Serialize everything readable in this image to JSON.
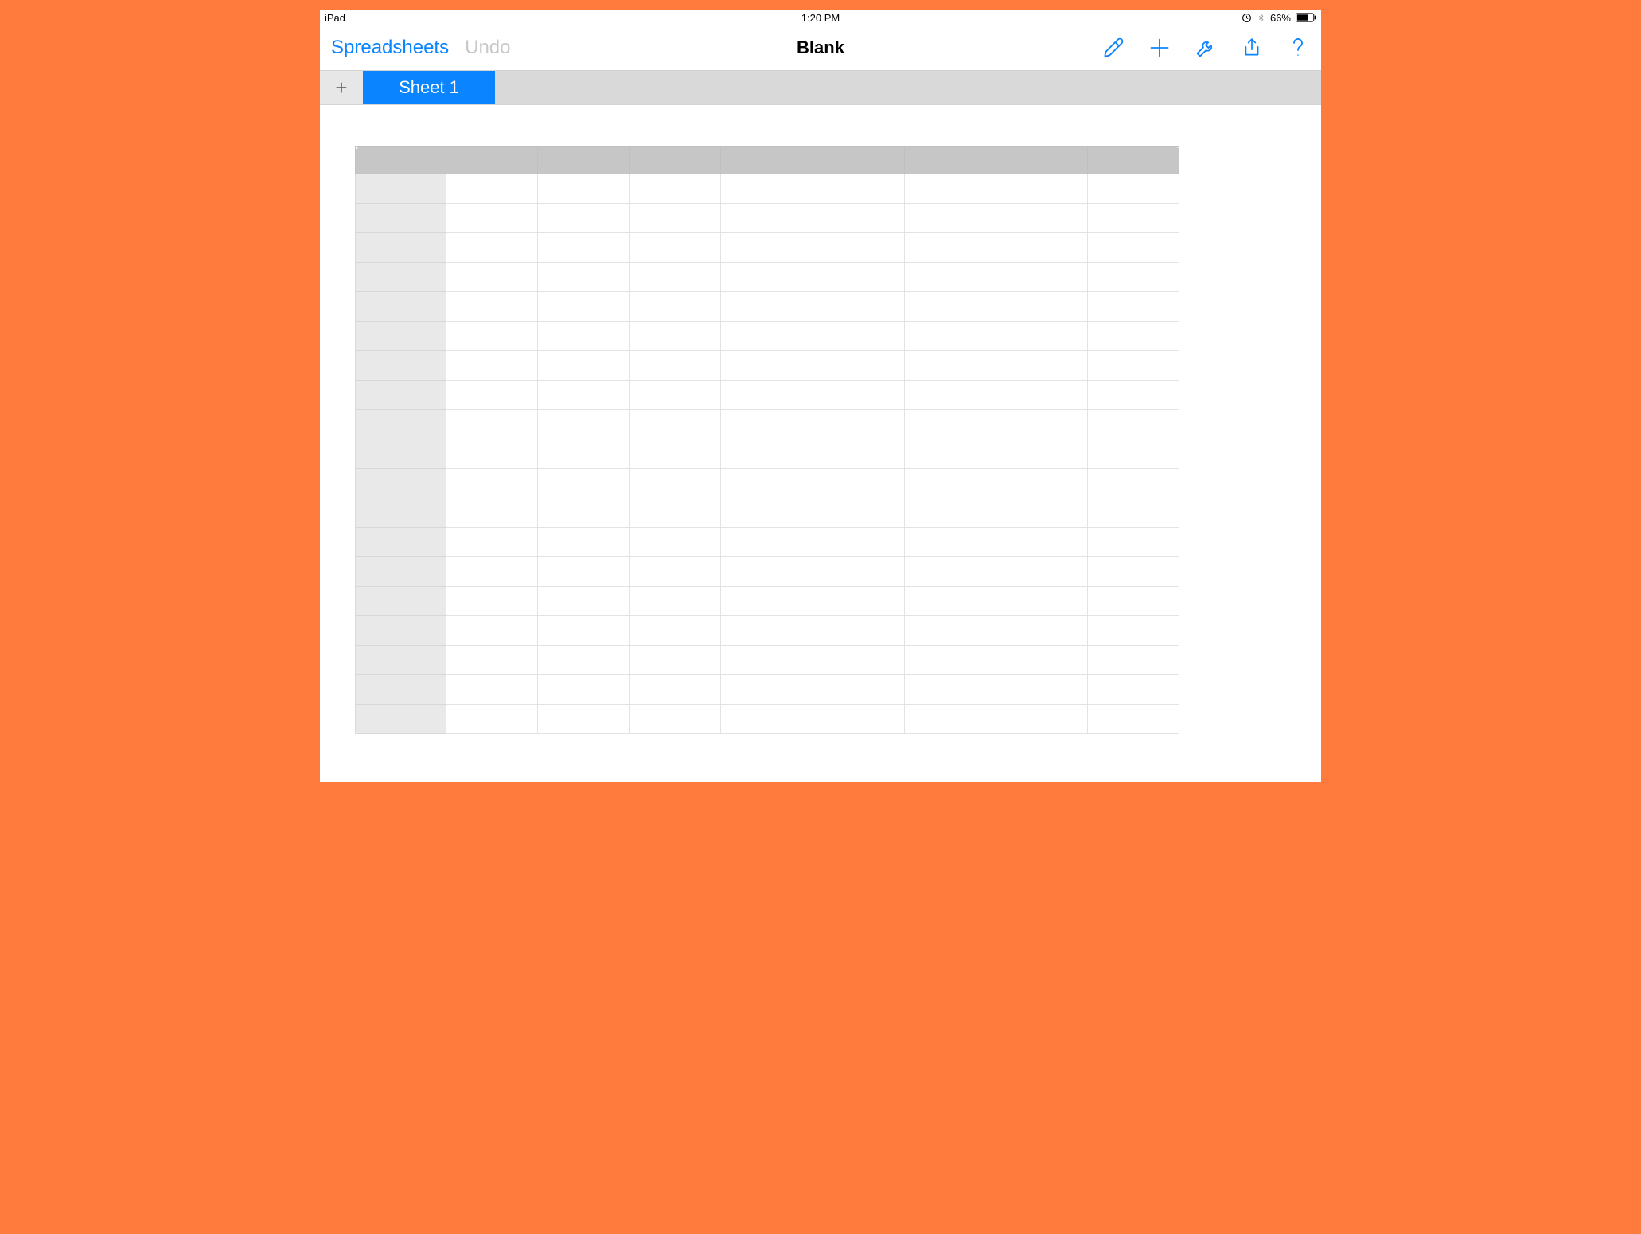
{
  "status_bar": {
    "device_label": "iPad",
    "time": "1:20 PM",
    "battery_percent": "66%"
  },
  "toolbar": {
    "back_label": "Spreadsheets",
    "undo_label": "Undo",
    "document_title": "Blank",
    "icons": {
      "paint": "paintbrush-icon",
      "add": "plus-icon",
      "tools": "wrench-icon",
      "share": "share-icon",
      "help": "help-icon"
    }
  },
  "sheet_tabs": {
    "add_symbol": "+",
    "tabs": [
      {
        "label": "Sheet 1",
        "active": true
      }
    ]
  },
  "grid": {
    "columns": 8,
    "rows": 19,
    "column_headers": [
      "",
      "",
      "",
      "",
      "",
      "",
      "",
      ""
    ],
    "row_headers": [
      "",
      "",
      "",
      "",
      "",
      "",
      "",
      "",
      "",
      "",
      "",
      "",
      "",
      "",
      "",
      "",
      "",
      "",
      ""
    ],
    "cells": []
  },
  "colors": {
    "accent": "#0a84ff",
    "frame": "#ff7a3d",
    "tab_bar": "#d9d9d9",
    "header_cell": "#c6c6c6",
    "row_header": "#e9e9e9"
  }
}
